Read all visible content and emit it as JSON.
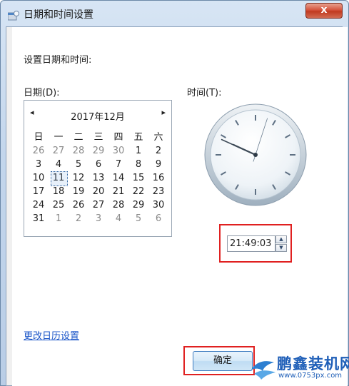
{
  "window": {
    "title": "日期和时间设置",
    "close_label": "x"
  },
  "prompt": "设置日期和时间:",
  "date_label": "日期(D):",
  "time_label": "时间(T):",
  "calendar": {
    "prev": "◂",
    "next": "▸",
    "month_title": "2017年12月",
    "weekdays": [
      "日",
      "一",
      "二",
      "三",
      "四",
      "五",
      "六"
    ],
    "weeks": [
      [
        "26",
        "27",
        "28",
        "29",
        "30",
        "1",
        "2"
      ],
      [
        "3",
        "4",
        "5",
        "6",
        "7",
        "8",
        "9"
      ],
      [
        "10",
        "11",
        "12",
        "13",
        "14",
        "15",
        "16"
      ],
      [
        "17",
        "18",
        "19",
        "20",
        "21",
        "22",
        "23"
      ],
      [
        "24",
        "25",
        "26",
        "27",
        "28",
        "29",
        "30"
      ],
      [
        "31",
        "1",
        "2",
        "3",
        "4",
        "5",
        "6"
      ]
    ],
    "selected_day": "11"
  },
  "clock": {
    "hour": 21,
    "minute": 49,
    "second": 3
  },
  "time_value": "21:49:03",
  "change_calendar_link": "更改日历设置",
  "ok_label": "确定",
  "watermark": {
    "title": "鹏鑫装机网",
    "url": "www.0753px.com"
  },
  "colors": {
    "link": "#1a55c8",
    "highlight_box": "#e02020"
  }
}
